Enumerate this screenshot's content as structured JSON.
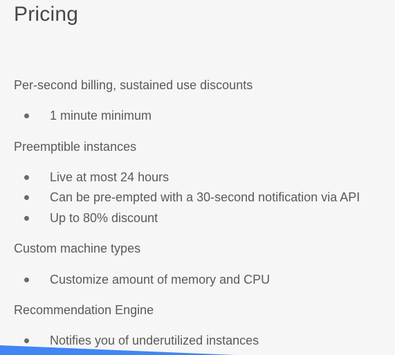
{
  "slide": {
    "title": "Pricing",
    "sections": [
      {
        "heading": "Per-second billing, sustained use discounts",
        "bullets": [
          "1 minute minimum"
        ]
      },
      {
        "heading": "Preemptible instances",
        "bullets": [
          "Live at most 24 hours",
          "Can be pre-empted with a 30-second notification via API",
          "Up to 80% discount"
        ]
      },
      {
        "heading": "Custom machine types",
        "bullets": [
          "Customize amount of memory and CPU"
        ]
      },
      {
        "heading": "Recommendation Engine",
        "bullets": [
          "Notifies you of underutilized instances"
        ]
      }
    ]
  },
  "colors": {
    "background": "#f6f6f6",
    "text": "#5a5a5a",
    "accent": "#4285f4"
  }
}
